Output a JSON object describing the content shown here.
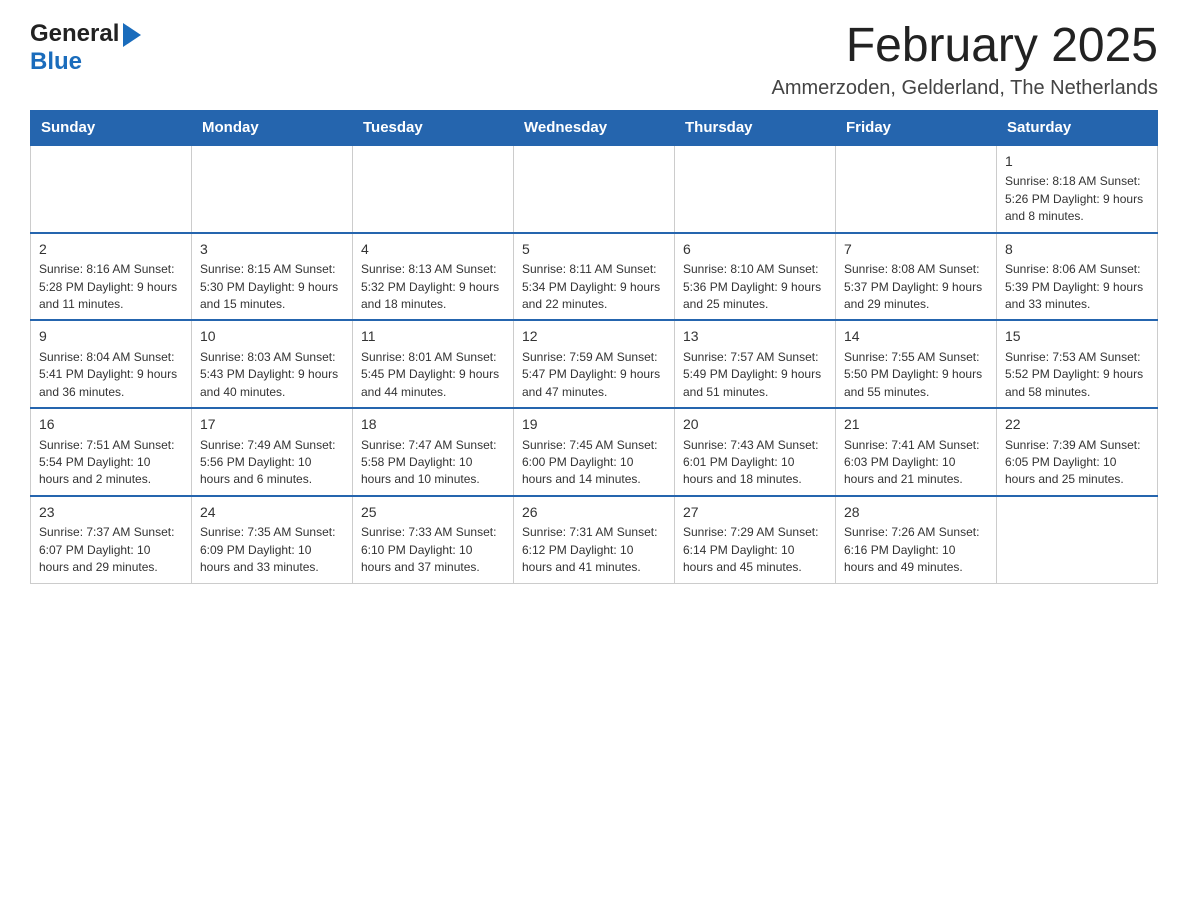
{
  "header": {
    "logo_general": "General",
    "logo_blue": "Blue",
    "month_title": "February 2025",
    "location": "Ammerzoden, Gelderland, The Netherlands"
  },
  "calendar": {
    "days_of_week": [
      "Sunday",
      "Monday",
      "Tuesday",
      "Wednesday",
      "Thursday",
      "Friday",
      "Saturday"
    ],
    "weeks": [
      [
        {
          "day": "",
          "info": ""
        },
        {
          "day": "",
          "info": ""
        },
        {
          "day": "",
          "info": ""
        },
        {
          "day": "",
          "info": ""
        },
        {
          "day": "",
          "info": ""
        },
        {
          "day": "",
          "info": ""
        },
        {
          "day": "1",
          "info": "Sunrise: 8:18 AM\nSunset: 5:26 PM\nDaylight: 9 hours and 8 minutes."
        }
      ],
      [
        {
          "day": "2",
          "info": "Sunrise: 8:16 AM\nSunset: 5:28 PM\nDaylight: 9 hours and 11 minutes."
        },
        {
          "day": "3",
          "info": "Sunrise: 8:15 AM\nSunset: 5:30 PM\nDaylight: 9 hours and 15 minutes."
        },
        {
          "day": "4",
          "info": "Sunrise: 8:13 AM\nSunset: 5:32 PM\nDaylight: 9 hours and 18 minutes."
        },
        {
          "day": "5",
          "info": "Sunrise: 8:11 AM\nSunset: 5:34 PM\nDaylight: 9 hours and 22 minutes."
        },
        {
          "day": "6",
          "info": "Sunrise: 8:10 AM\nSunset: 5:36 PM\nDaylight: 9 hours and 25 minutes."
        },
        {
          "day": "7",
          "info": "Sunrise: 8:08 AM\nSunset: 5:37 PM\nDaylight: 9 hours and 29 minutes."
        },
        {
          "day": "8",
          "info": "Sunrise: 8:06 AM\nSunset: 5:39 PM\nDaylight: 9 hours and 33 minutes."
        }
      ],
      [
        {
          "day": "9",
          "info": "Sunrise: 8:04 AM\nSunset: 5:41 PM\nDaylight: 9 hours and 36 minutes."
        },
        {
          "day": "10",
          "info": "Sunrise: 8:03 AM\nSunset: 5:43 PM\nDaylight: 9 hours and 40 minutes."
        },
        {
          "day": "11",
          "info": "Sunrise: 8:01 AM\nSunset: 5:45 PM\nDaylight: 9 hours and 44 minutes."
        },
        {
          "day": "12",
          "info": "Sunrise: 7:59 AM\nSunset: 5:47 PM\nDaylight: 9 hours and 47 minutes."
        },
        {
          "day": "13",
          "info": "Sunrise: 7:57 AM\nSunset: 5:49 PM\nDaylight: 9 hours and 51 minutes."
        },
        {
          "day": "14",
          "info": "Sunrise: 7:55 AM\nSunset: 5:50 PM\nDaylight: 9 hours and 55 minutes."
        },
        {
          "day": "15",
          "info": "Sunrise: 7:53 AM\nSunset: 5:52 PM\nDaylight: 9 hours and 58 minutes."
        }
      ],
      [
        {
          "day": "16",
          "info": "Sunrise: 7:51 AM\nSunset: 5:54 PM\nDaylight: 10 hours and 2 minutes."
        },
        {
          "day": "17",
          "info": "Sunrise: 7:49 AM\nSunset: 5:56 PM\nDaylight: 10 hours and 6 minutes."
        },
        {
          "day": "18",
          "info": "Sunrise: 7:47 AM\nSunset: 5:58 PM\nDaylight: 10 hours and 10 minutes."
        },
        {
          "day": "19",
          "info": "Sunrise: 7:45 AM\nSunset: 6:00 PM\nDaylight: 10 hours and 14 minutes."
        },
        {
          "day": "20",
          "info": "Sunrise: 7:43 AM\nSunset: 6:01 PM\nDaylight: 10 hours and 18 minutes."
        },
        {
          "day": "21",
          "info": "Sunrise: 7:41 AM\nSunset: 6:03 PM\nDaylight: 10 hours and 21 minutes."
        },
        {
          "day": "22",
          "info": "Sunrise: 7:39 AM\nSunset: 6:05 PM\nDaylight: 10 hours and 25 minutes."
        }
      ],
      [
        {
          "day": "23",
          "info": "Sunrise: 7:37 AM\nSunset: 6:07 PM\nDaylight: 10 hours and 29 minutes."
        },
        {
          "day": "24",
          "info": "Sunrise: 7:35 AM\nSunset: 6:09 PM\nDaylight: 10 hours and 33 minutes."
        },
        {
          "day": "25",
          "info": "Sunrise: 7:33 AM\nSunset: 6:10 PM\nDaylight: 10 hours and 37 minutes."
        },
        {
          "day": "26",
          "info": "Sunrise: 7:31 AM\nSunset: 6:12 PM\nDaylight: 10 hours and 41 minutes."
        },
        {
          "day": "27",
          "info": "Sunrise: 7:29 AM\nSunset: 6:14 PM\nDaylight: 10 hours and 45 minutes."
        },
        {
          "day": "28",
          "info": "Sunrise: 7:26 AM\nSunset: 6:16 PM\nDaylight: 10 hours and 49 minutes."
        },
        {
          "day": "",
          "info": ""
        }
      ]
    ]
  }
}
